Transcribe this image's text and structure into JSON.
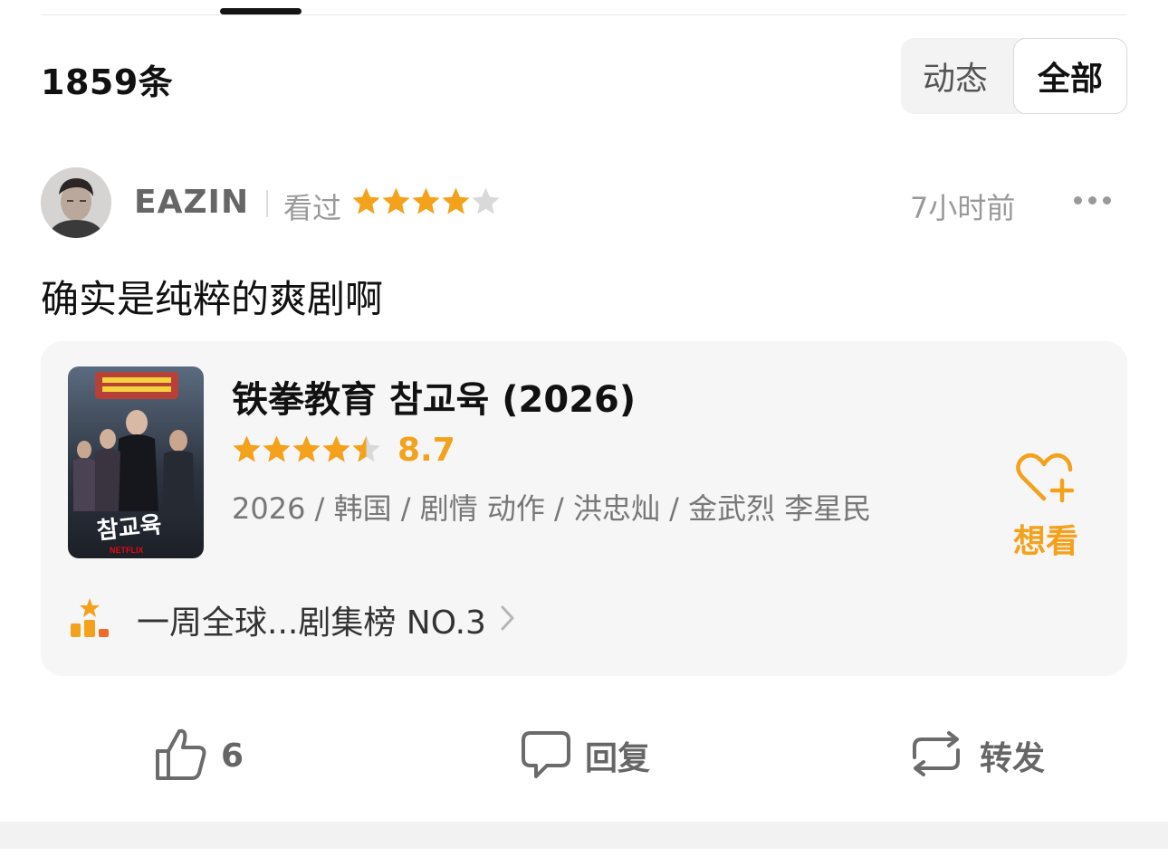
{
  "header": {
    "count_label": "1859条",
    "segments": [
      "动态",
      "全部"
    ],
    "selected_segment": "全部"
  },
  "post": {
    "username": "EAZIN",
    "status": "看过",
    "user_rating": 4,
    "user_rating_max": 5,
    "time": "7小时前",
    "text": "确实是纯粹的爽剧啊"
  },
  "movie": {
    "title": "铁拳教育 참교육 (2026)",
    "rating": 4.5,
    "score": "8.7",
    "meta": "2026 / 韩国 / 剧情 动作 / 洪忠灿 / 金武烈 李星民",
    "want_label": "想看",
    "rank_text": "一周全球...剧集榜 NO.3",
    "poster_text": "참교육",
    "poster_brand": "NETFLIX"
  },
  "actions": {
    "like_count": "6",
    "reply_label": "回复",
    "share_label": "转发"
  },
  "colors": {
    "accent": "#f4a11b",
    "star_empty": "#d9d9d9",
    "muted_text": "#999999"
  },
  "icons": [
    "star-icon",
    "more-icon",
    "heart-plus-icon",
    "rank-icon",
    "chevron-right-icon",
    "thumbs-up-icon",
    "comment-icon",
    "repost-icon"
  ]
}
